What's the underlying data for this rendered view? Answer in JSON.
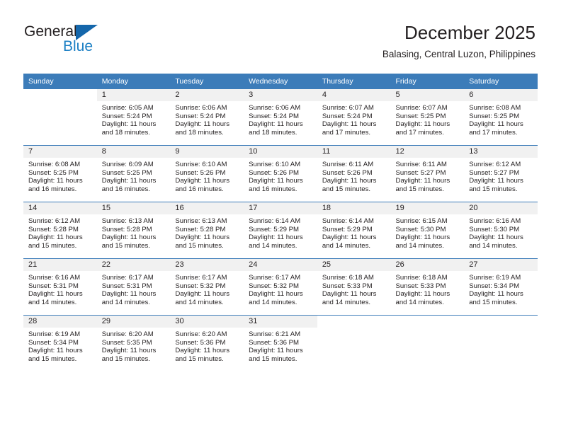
{
  "logo": {
    "text_top": "General",
    "text_bottom": "Blue",
    "accent_color": "#1567ab"
  },
  "header": {
    "title": "December 2025",
    "location": "Balasing, Central Luzon, Philippines"
  },
  "theme": {
    "header_row_bg": "#3c7cb9",
    "daynum_band_bg": "#f1f1f1",
    "text_color": "#231f20"
  },
  "weekday_headers": [
    "Sunday",
    "Monday",
    "Tuesday",
    "Wednesday",
    "Thursday",
    "Friday",
    "Saturday"
  ],
  "weeks": [
    [
      {
        "day": "",
        "sunrise": "",
        "sunset": "",
        "daylight_line1": "",
        "daylight_line2": ""
      },
      {
        "day": "1",
        "sunrise": "Sunrise: 6:05 AM",
        "sunset": "Sunset: 5:24 PM",
        "daylight_line1": "Daylight: 11 hours",
        "daylight_line2": "and 18 minutes."
      },
      {
        "day": "2",
        "sunrise": "Sunrise: 6:06 AM",
        "sunset": "Sunset: 5:24 PM",
        "daylight_line1": "Daylight: 11 hours",
        "daylight_line2": "and 18 minutes."
      },
      {
        "day": "3",
        "sunrise": "Sunrise: 6:06 AM",
        "sunset": "Sunset: 5:24 PM",
        "daylight_line1": "Daylight: 11 hours",
        "daylight_line2": "and 18 minutes."
      },
      {
        "day": "4",
        "sunrise": "Sunrise: 6:07 AM",
        "sunset": "Sunset: 5:24 PM",
        "daylight_line1": "Daylight: 11 hours",
        "daylight_line2": "and 17 minutes."
      },
      {
        "day": "5",
        "sunrise": "Sunrise: 6:07 AM",
        "sunset": "Sunset: 5:25 PM",
        "daylight_line1": "Daylight: 11 hours",
        "daylight_line2": "and 17 minutes."
      },
      {
        "day": "6",
        "sunrise": "Sunrise: 6:08 AM",
        "sunset": "Sunset: 5:25 PM",
        "daylight_line1": "Daylight: 11 hours",
        "daylight_line2": "and 17 minutes."
      }
    ],
    [
      {
        "day": "7",
        "sunrise": "Sunrise: 6:08 AM",
        "sunset": "Sunset: 5:25 PM",
        "daylight_line1": "Daylight: 11 hours",
        "daylight_line2": "and 16 minutes."
      },
      {
        "day": "8",
        "sunrise": "Sunrise: 6:09 AM",
        "sunset": "Sunset: 5:25 PM",
        "daylight_line1": "Daylight: 11 hours",
        "daylight_line2": "and 16 minutes."
      },
      {
        "day": "9",
        "sunrise": "Sunrise: 6:10 AM",
        "sunset": "Sunset: 5:26 PM",
        "daylight_line1": "Daylight: 11 hours",
        "daylight_line2": "and 16 minutes."
      },
      {
        "day": "10",
        "sunrise": "Sunrise: 6:10 AM",
        "sunset": "Sunset: 5:26 PM",
        "daylight_line1": "Daylight: 11 hours",
        "daylight_line2": "and 16 minutes."
      },
      {
        "day": "11",
        "sunrise": "Sunrise: 6:11 AM",
        "sunset": "Sunset: 5:26 PM",
        "daylight_line1": "Daylight: 11 hours",
        "daylight_line2": "and 15 minutes."
      },
      {
        "day": "12",
        "sunrise": "Sunrise: 6:11 AM",
        "sunset": "Sunset: 5:27 PM",
        "daylight_line1": "Daylight: 11 hours",
        "daylight_line2": "and 15 minutes."
      },
      {
        "day": "13",
        "sunrise": "Sunrise: 6:12 AM",
        "sunset": "Sunset: 5:27 PM",
        "daylight_line1": "Daylight: 11 hours",
        "daylight_line2": "and 15 minutes."
      }
    ],
    [
      {
        "day": "14",
        "sunrise": "Sunrise: 6:12 AM",
        "sunset": "Sunset: 5:28 PM",
        "daylight_line1": "Daylight: 11 hours",
        "daylight_line2": "and 15 minutes."
      },
      {
        "day": "15",
        "sunrise": "Sunrise: 6:13 AM",
        "sunset": "Sunset: 5:28 PM",
        "daylight_line1": "Daylight: 11 hours",
        "daylight_line2": "and 15 minutes."
      },
      {
        "day": "16",
        "sunrise": "Sunrise: 6:13 AM",
        "sunset": "Sunset: 5:28 PM",
        "daylight_line1": "Daylight: 11 hours",
        "daylight_line2": "and 15 minutes."
      },
      {
        "day": "17",
        "sunrise": "Sunrise: 6:14 AM",
        "sunset": "Sunset: 5:29 PM",
        "daylight_line1": "Daylight: 11 hours",
        "daylight_line2": "and 14 minutes."
      },
      {
        "day": "18",
        "sunrise": "Sunrise: 6:14 AM",
        "sunset": "Sunset: 5:29 PM",
        "daylight_line1": "Daylight: 11 hours",
        "daylight_line2": "and 14 minutes."
      },
      {
        "day": "19",
        "sunrise": "Sunrise: 6:15 AM",
        "sunset": "Sunset: 5:30 PM",
        "daylight_line1": "Daylight: 11 hours",
        "daylight_line2": "and 14 minutes."
      },
      {
        "day": "20",
        "sunrise": "Sunrise: 6:16 AM",
        "sunset": "Sunset: 5:30 PM",
        "daylight_line1": "Daylight: 11 hours",
        "daylight_line2": "and 14 minutes."
      }
    ],
    [
      {
        "day": "21",
        "sunrise": "Sunrise: 6:16 AM",
        "sunset": "Sunset: 5:31 PM",
        "daylight_line1": "Daylight: 11 hours",
        "daylight_line2": "and 14 minutes."
      },
      {
        "day": "22",
        "sunrise": "Sunrise: 6:17 AM",
        "sunset": "Sunset: 5:31 PM",
        "daylight_line1": "Daylight: 11 hours",
        "daylight_line2": "and 14 minutes."
      },
      {
        "day": "23",
        "sunrise": "Sunrise: 6:17 AM",
        "sunset": "Sunset: 5:32 PM",
        "daylight_line1": "Daylight: 11 hours",
        "daylight_line2": "and 14 minutes."
      },
      {
        "day": "24",
        "sunrise": "Sunrise: 6:17 AM",
        "sunset": "Sunset: 5:32 PM",
        "daylight_line1": "Daylight: 11 hours",
        "daylight_line2": "and 14 minutes."
      },
      {
        "day": "25",
        "sunrise": "Sunrise: 6:18 AM",
        "sunset": "Sunset: 5:33 PM",
        "daylight_line1": "Daylight: 11 hours",
        "daylight_line2": "and 14 minutes."
      },
      {
        "day": "26",
        "sunrise": "Sunrise: 6:18 AM",
        "sunset": "Sunset: 5:33 PM",
        "daylight_line1": "Daylight: 11 hours",
        "daylight_line2": "and 14 minutes."
      },
      {
        "day": "27",
        "sunrise": "Sunrise: 6:19 AM",
        "sunset": "Sunset: 5:34 PM",
        "daylight_line1": "Daylight: 11 hours",
        "daylight_line2": "and 15 minutes."
      }
    ],
    [
      {
        "day": "28",
        "sunrise": "Sunrise: 6:19 AM",
        "sunset": "Sunset: 5:34 PM",
        "daylight_line1": "Daylight: 11 hours",
        "daylight_line2": "and 15 minutes."
      },
      {
        "day": "29",
        "sunrise": "Sunrise: 6:20 AM",
        "sunset": "Sunset: 5:35 PM",
        "daylight_line1": "Daylight: 11 hours",
        "daylight_line2": "and 15 minutes."
      },
      {
        "day": "30",
        "sunrise": "Sunrise: 6:20 AM",
        "sunset": "Sunset: 5:36 PM",
        "daylight_line1": "Daylight: 11 hours",
        "daylight_line2": "and 15 minutes."
      },
      {
        "day": "31",
        "sunrise": "Sunrise: 6:21 AM",
        "sunset": "Sunset: 5:36 PM",
        "daylight_line1": "Daylight: 11 hours",
        "daylight_line2": "and 15 minutes."
      },
      {
        "day": "",
        "sunrise": "",
        "sunset": "",
        "daylight_line1": "",
        "daylight_line2": ""
      },
      {
        "day": "",
        "sunrise": "",
        "sunset": "",
        "daylight_line1": "",
        "daylight_line2": ""
      },
      {
        "day": "",
        "sunrise": "",
        "sunset": "",
        "daylight_line1": "",
        "daylight_line2": ""
      }
    ]
  ]
}
